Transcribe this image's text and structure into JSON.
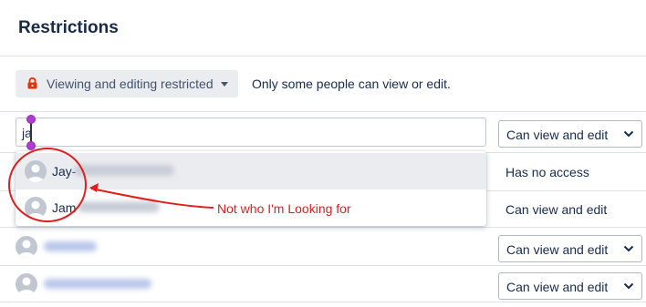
{
  "header": {
    "title": "Restrictions"
  },
  "restriction_mode": {
    "button_label": "Viewing and editing restricted",
    "description": "Only some people can view or edit.",
    "lock_icon": "lock-icon",
    "lock_color": "#de350b"
  },
  "search": {
    "value": "ja",
    "permission": "Can view and edit"
  },
  "suggestions": [
    {
      "name_visible": "Jay-"
    },
    {
      "name_visible": "Jam"
    }
  ],
  "rows": [
    {
      "access": "Has no access"
    },
    {
      "access": "Can view and edit"
    },
    {
      "access": "Can view and edit"
    },
    {
      "access": "Can view and edit"
    }
  ],
  "annotation": {
    "text": "Not who I'm Looking for",
    "color": "#e01e1e"
  }
}
